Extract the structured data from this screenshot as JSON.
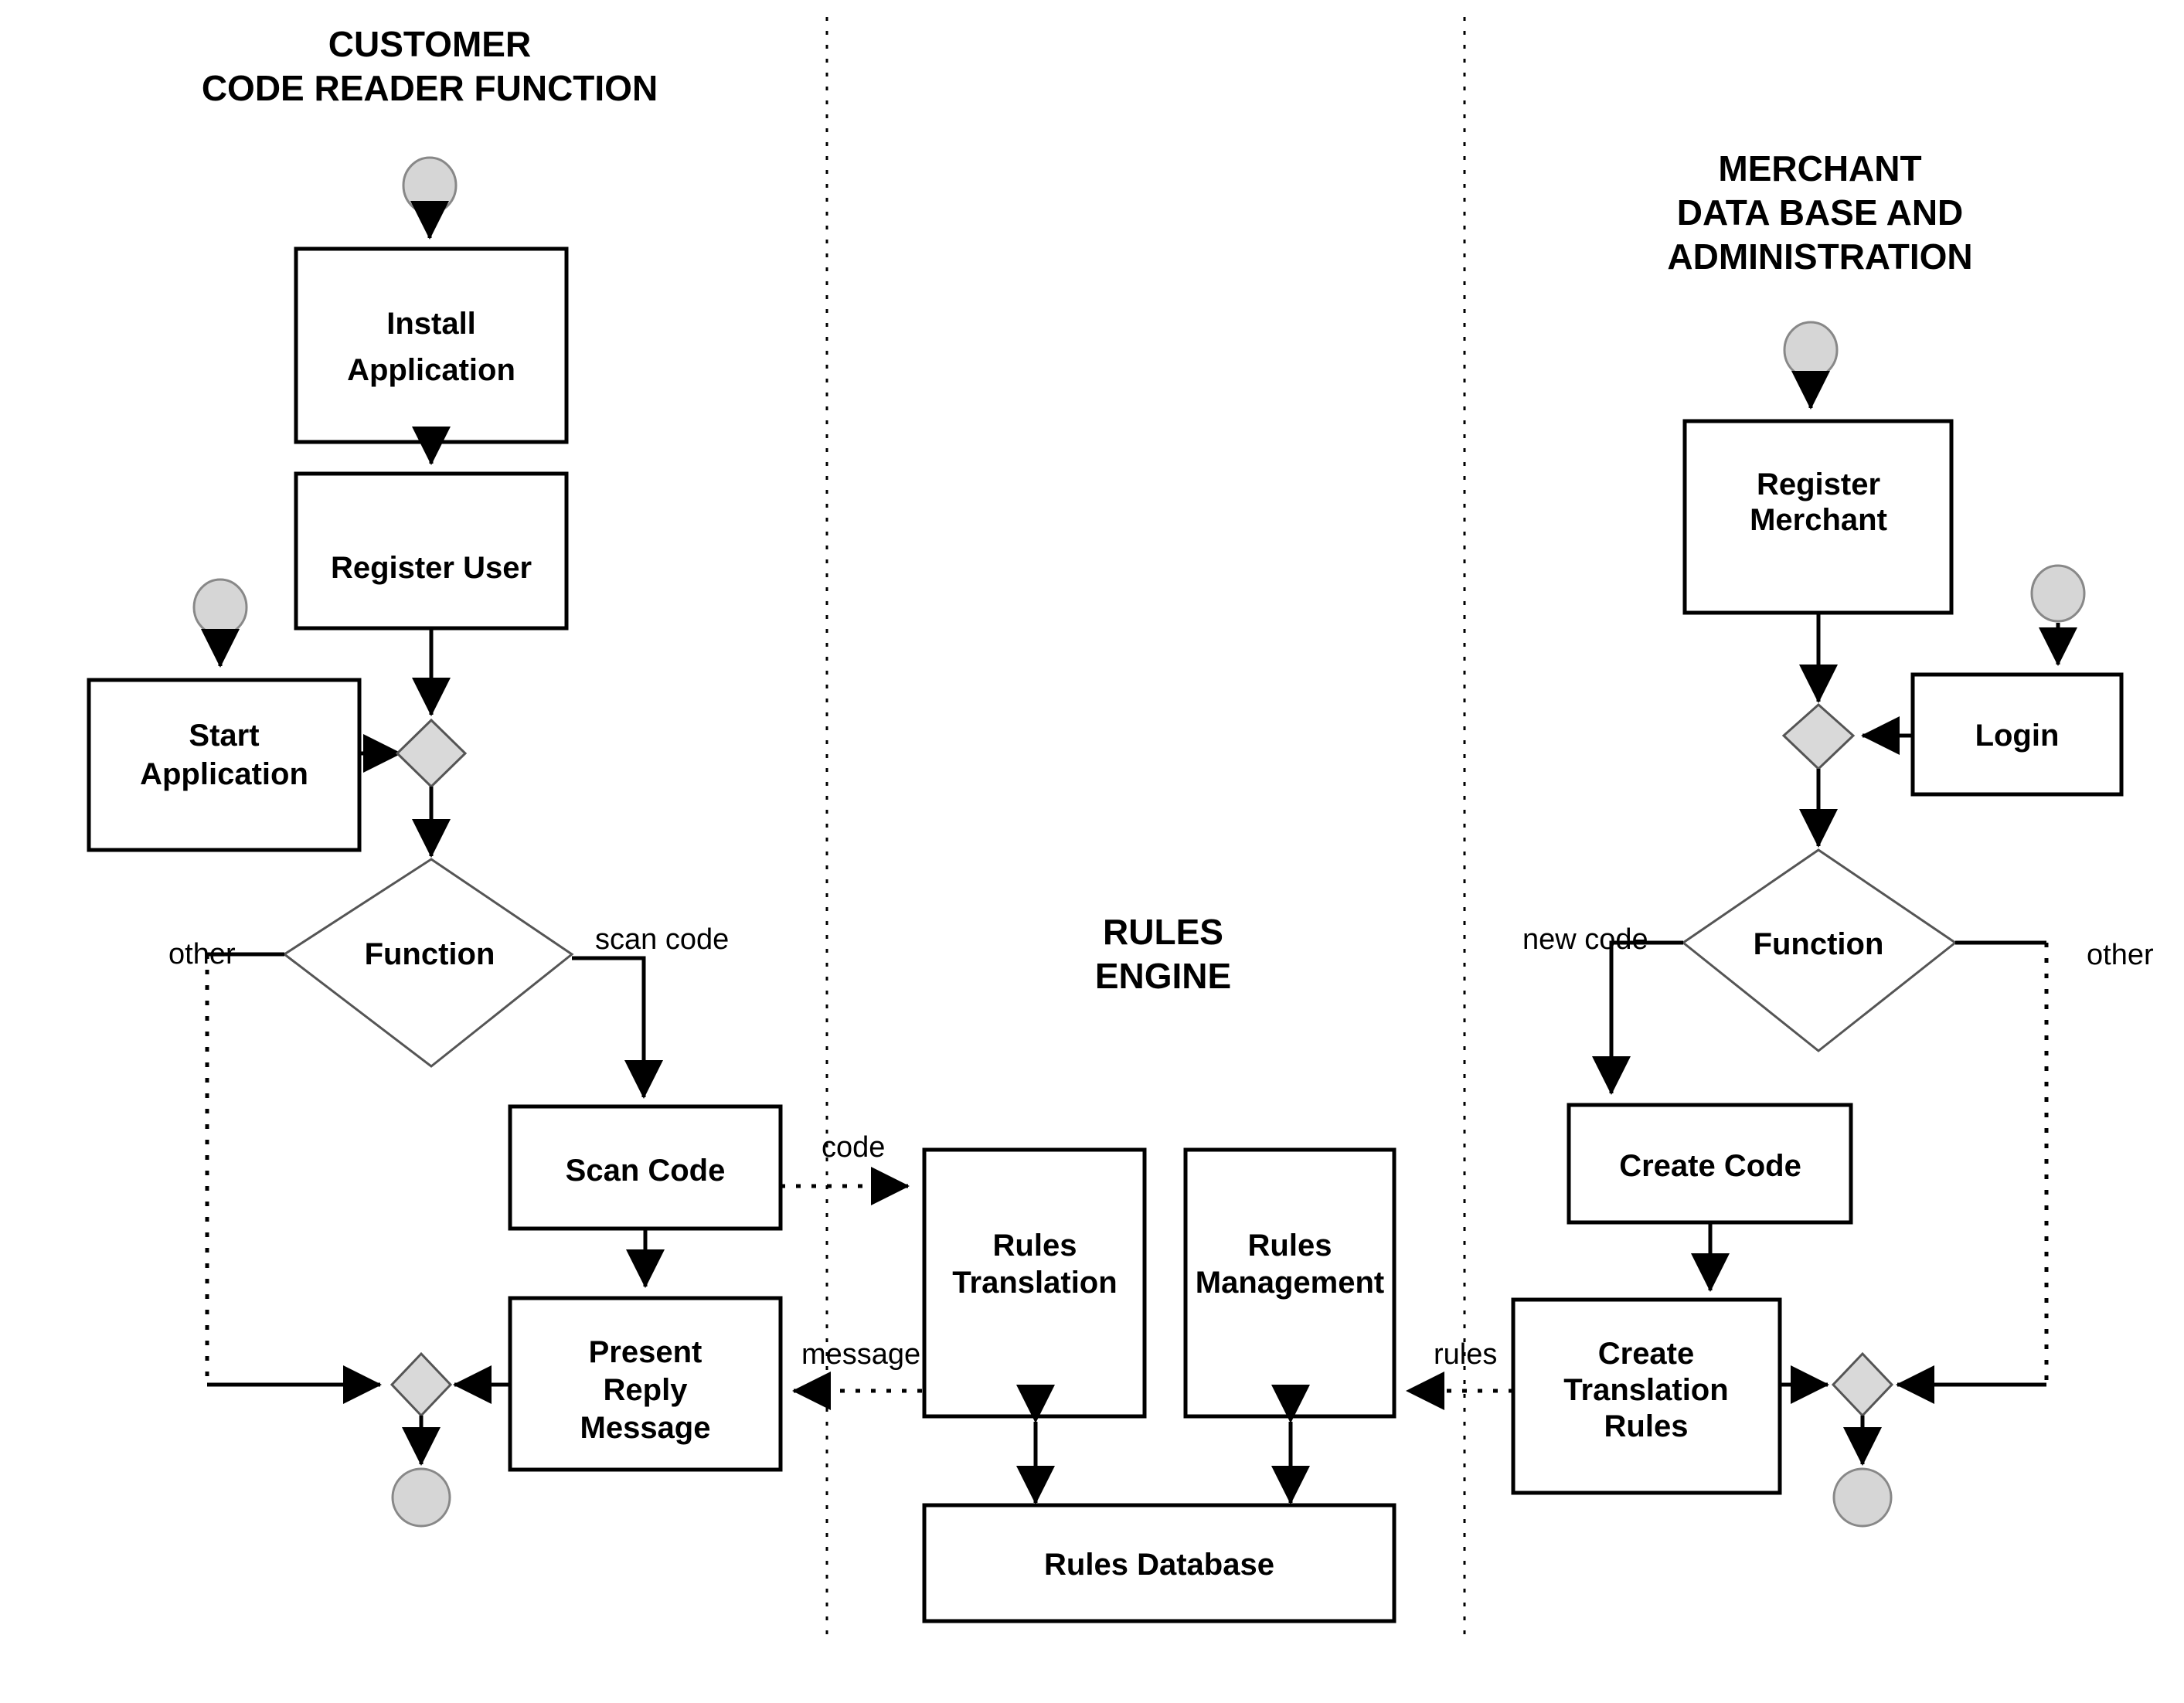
{
  "diagram": {
    "title_hidden": "",
    "lanes": [
      {
        "id": "customer",
        "title_line1": "CUSTOMER",
        "title_line2": "CODE READER FUNCTION",
        "title_line3": ""
      },
      {
        "id": "rules",
        "title_line1": "RULES",
        "title_line2": "ENGINE",
        "title_line3": ""
      },
      {
        "id": "merchant",
        "title_line1": "MERCHANT",
        "title_line2": "DATA BASE AND",
        "title_line3": "ADMINISTRATION"
      }
    ],
    "nodes": {
      "install_application_l1": "Install",
      "install_application_l2": "Application",
      "register_user": "Register User",
      "start_application_l1": "Start",
      "start_application_l2": "Application",
      "function_customer": "Function",
      "scan_code": "Scan Code",
      "present_reply_l1": "Present",
      "present_reply_l2": "Reply",
      "present_reply_l3": "Message",
      "rules_translation_l1": "Rules",
      "rules_translation_l2": "Translation",
      "rules_management_l1": "Rules",
      "rules_management_l2": "Management",
      "rules_database": "Rules Database",
      "register_merchant_l1": "Register",
      "register_merchant_l2": "Merchant",
      "login": "Login",
      "function_merchant": "Function",
      "create_code": "Create Code",
      "create_translation_rules_l1": "Create",
      "create_translation_rules_l2": "Translation",
      "create_translation_rules_l3": "Rules"
    },
    "edge_labels": {
      "customer_other": "other",
      "customer_scan_code": "scan code",
      "code": "code",
      "message": "message",
      "rules": "rules",
      "merchant_new_code": "new code",
      "merchant_other": "other"
    },
    "colors": {
      "stroke": "#000000",
      "fill": "#ffffff",
      "terminator_fill": "#d6d6d6",
      "merge_fill": "#d9d9d9"
    }
  }
}
